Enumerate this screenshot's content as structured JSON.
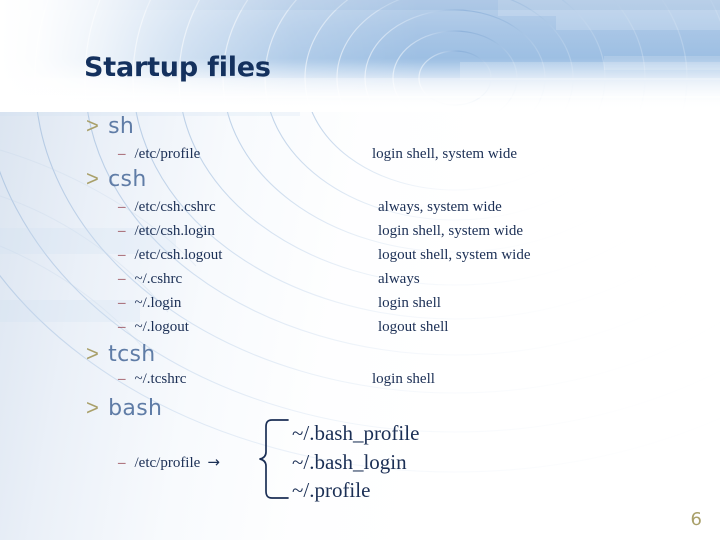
{
  "slide": {
    "title": "Startup files",
    "page_number": "6",
    "accent_olive": "#a9a06a",
    "accent_heading": "#5f7ca6",
    "accent_title": "#14315e",
    "accent_dash": "#8f3a46",
    "banner_blue": "#9dbfe3"
  },
  "sections": [
    {
      "marker": ">",
      "heading": "sh",
      "items": [
        {
          "dash": "–",
          "file": "/etc/profile",
          "desc": "login shell, system wide"
        }
      ]
    },
    {
      "marker": ">",
      "heading": "csh",
      "items": [
        {
          "dash": "–",
          "file": "/etc/csh.cshrc",
          "desc": "always, system wide"
        },
        {
          "dash": "–",
          "file": "/etc/csh.login",
          "desc": "login shell, system wide"
        },
        {
          "dash": "–",
          "file": "/etc/csh.logout",
          "desc": "logout shell, system wide"
        },
        {
          "dash": "–",
          "file": "~/.cshrc",
          "desc": "always"
        },
        {
          "dash": "–",
          "file": "~/.login",
          "desc": "login shell"
        },
        {
          "dash": "–",
          "file": "~/.logout",
          "desc": "logout shell"
        }
      ]
    },
    {
      "marker": ">",
      "heading": "tcsh",
      "items": [
        {
          "dash": "–",
          "file": "~/.tcshrc",
          "desc": "login shell"
        }
      ]
    },
    {
      "marker": ">",
      "heading": "bash",
      "items": [
        {
          "dash": "–",
          "file": "/etc/profile",
          "arrow": "→",
          "desc": ""
        }
      ],
      "brace_items": [
        "~/.bash_profile",
        "~/.bash_login",
        "~/.profile"
      ]
    }
  ]
}
